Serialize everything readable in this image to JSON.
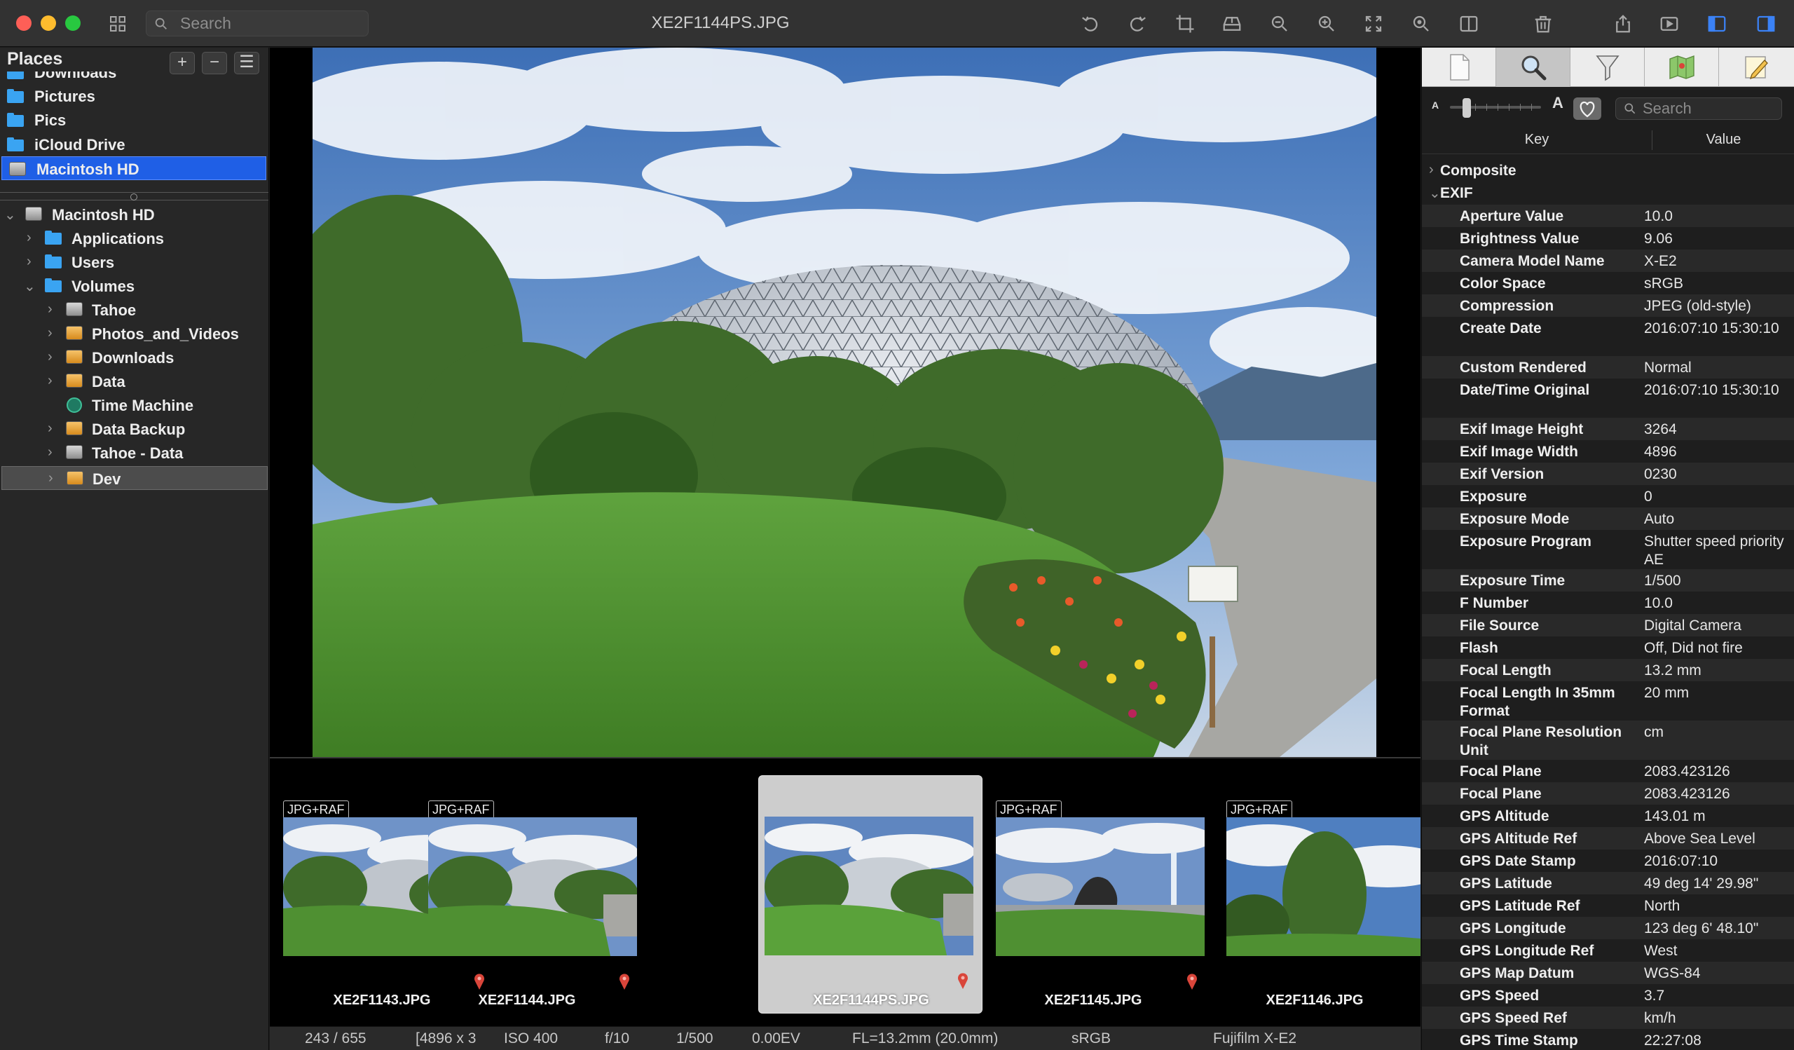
{
  "window": {
    "title": "XE2F1144PS.JPG"
  },
  "toolbar": {
    "search_placeholder": "Search",
    "icons": [
      "grid-icon",
      "rotate-left-icon",
      "rotate-right-icon",
      "crop-icon",
      "tray-download-icon",
      "zoom-out-icon",
      "zoom-in-icon",
      "fit-screen-icon",
      "actual-size-icon",
      "split-view-icon",
      "trash-icon",
      "share-icon",
      "slideshow-icon",
      "left-panel-icon",
      "right-panel-icon"
    ]
  },
  "sidebar": {
    "title": "Places",
    "buttons": [
      "+",
      "−",
      "☰"
    ],
    "places": [
      {
        "label": "Downloads",
        "icon": "folder-icon"
      },
      {
        "label": "Pictures",
        "icon": "folder-icon"
      },
      {
        "label": "Pics",
        "icon": "folder-icon"
      },
      {
        "label": "iCloud Drive",
        "icon": "folder-icon"
      },
      {
        "label": "Macintosh HD",
        "icon": "drive-icon",
        "selected": true
      }
    ],
    "tree": [
      {
        "label": "Macintosh HD",
        "expanded": true
      },
      {
        "label": "Applications"
      },
      {
        "label": "Users"
      },
      {
        "label": "Volumes",
        "expanded": true
      },
      {
        "label": "Tahoe"
      },
      {
        "label": "Photos_and_Videos"
      },
      {
        "label": "Downloads"
      },
      {
        "label": "Data"
      },
      {
        "label": "Time Machine"
      },
      {
        "label": "Data Backup"
      },
      {
        "label": "Tahoe - Data"
      },
      {
        "label": "Dev",
        "selected": true
      }
    ]
  },
  "filmstrip": {
    "items": [
      {
        "badge": "JPG+RAF",
        "name": "XE2F1143.JPG"
      },
      {
        "badge": "JPG+RAF",
        "name": "XE2F1144.JPG"
      },
      {
        "badge": "",
        "name": "XE2F1144PS.JPG",
        "selected": true
      },
      {
        "badge": "JPG+RAF",
        "name": "XE2F1145.JPG"
      },
      {
        "badge": "JPG+RAF",
        "name": "XE2F1146.JPG"
      }
    ]
  },
  "status": {
    "index": "243 / 655",
    "dims": "[4896 x 3",
    "iso": "ISO 400",
    "aperture": "f/10",
    "shutter": "1/500",
    "ev": "0.00EV",
    "fl": "FL=13.2mm (20.0mm)",
    "colorspace": "sRGB",
    "camera": "Fujifilm X-E2"
  },
  "inspector": {
    "search_placeholder": "Search",
    "small_a": "A",
    "big_a": "A",
    "col_key": "Key",
    "col_value": "Value",
    "groups": [
      {
        "label": "Composite",
        "expanded": false
      },
      {
        "label": "EXIF",
        "expanded": true
      }
    ],
    "rows": [
      {
        "k": "Aperture Value",
        "v": "10.0"
      },
      {
        "k": "Brightness Value",
        "v": "9.06"
      },
      {
        "k": "Camera Model Name",
        "v": "X-E2"
      },
      {
        "k": "Color Space",
        "v": "sRGB"
      },
      {
        "k": "Compression",
        "v": "JPEG (old-style)"
      },
      {
        "k": "Create Date",
        "v": "2016:07:10 15:30:10"
      },
      {
        "k": "Custom Rendered",
        "v": "Normal"
      },
      {
        "k": "Date/Time Original",
        "v": "2016:07:10 15:30:10"
      },
      {
        "k": "Exif Image Height",
        "v": "3264"
      },
      {
        "k": "Exif Image Width",
        "v": "4896"
      },
      {
        "k": "Exif Version",
        "v": "0230"
      },
      {
        "k": "Exposure",
        "v": "0"
      },
      {
        "k": "Exposure Mode",
        "v": "Auto"
      },
      {
        "k": "Exposure Program",
        "v": "Shutter speed priority AE"
      },
      {
        "k": "Exposure Time",
        "v": "1/500"
      },
      {
        "k": "F Number",
        "v": "10.0"
      },
      {
        "k": "File Source",
        "v": "Digital Camera"
      },
      {
        "k": "Flash",
        "v": "Off, Did not fire"
      },
      {
        "k": "Focal Length",
        "v": "13.2 mm"
      },
      {
        "k": "Focal Length In 35mm Format",
        "v": "20 mm"
      },
      {
        "k": "Focal Plane Resolution Unit",
        "v": "cm"
      },
      {
        "k": "Focal Plane",
        "v": "2083.423126"
      },
      {
        "k": "Focal Plane",
        "v": "2083.423126"
      },
      {
        "k": "GPS Altitude",
        "v": "143.01 m"
      },
      {
        "k": "GPS Altitude Ref",
        "v": "Above Sea Level"
      },
      {
        "k": "GPS Date Stamp",
        "v": "2016:07:10"
      },
      {
        "k": "GPS Latitude",
        "v": "49 deg 14' 29.98\""
      },
      {
        "k": "GPS Latitude Ref",
        "v": "North"
      },
      {
        "k": "GPS Longitude",
        "v": "123 deg 6' 48.10\""
      },
      {
        "k": "GPS Longitude Ref",
        "v": "West"
      },
      {
        "k": "GPS Map Datum",
        "v": "WGS-84"
      },
      {
        "k": "GPS Speed",
        "v": "3.7"
      },
      {
        "k": "GPS Speed Ref",
        "v": "km/h"
      },
      {
        "k": "GPS Time Stamp",
        "v": "22:27:08"
      }
    ]
  }
}
